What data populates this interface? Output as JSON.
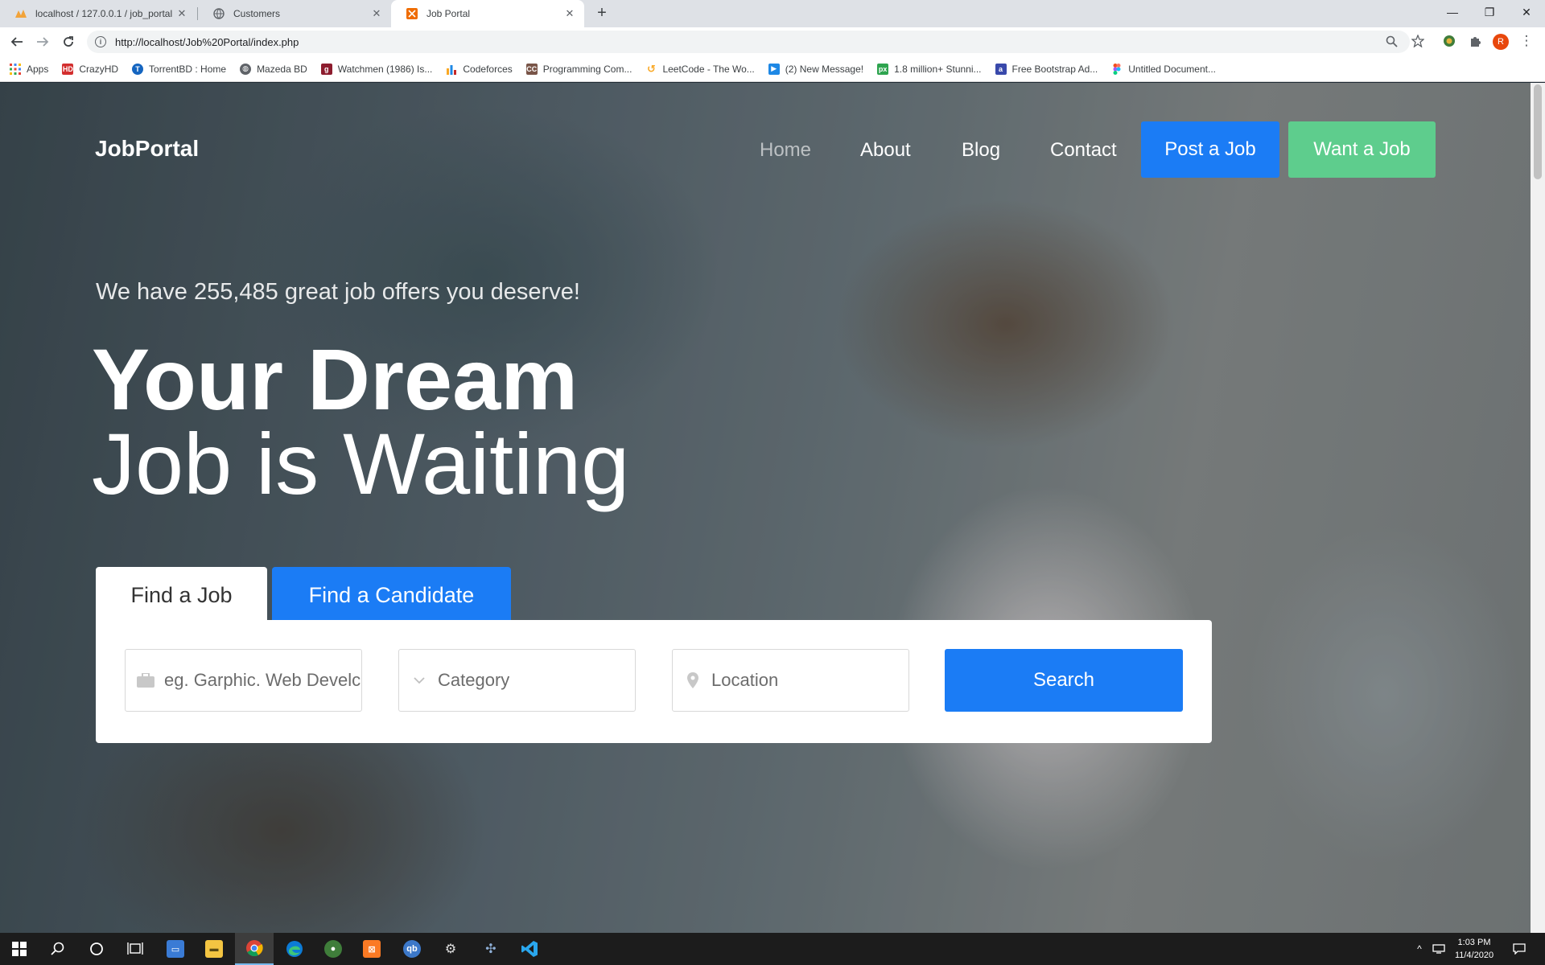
{
  "browser": {
    "tabs": [
      {
        "title": "localhost / 127.0.0.1 / job_portal",
        "icon": "phpmyadmin-icon",
        "active": false
      },
      {
        "title": "Customers",
        "icon": "globe-icon",
        "active": false
      },
      {
        "title": "Job Portal",
        "icon": "site-icon",
        "active": true
      }
    ],
    "url": "http://localhost/Job%20Portal/index.php",
    "profile_initial": "R",
    "bookmarks": [
      {
        "label": "Apps",
        "icon": "apps-grid-icon",
        "color": "#4285f4"
      },
      {
        "label": "CrazyHD",
        "icon": "crazyhd-icon",
        "color": "#d32f2f"
      },
      {
        "label": "TorrentBD : Home",
        "icon": "torrentbd-icon",
        "color": "#1565c0"
      },
      {
        "label": "Mazeda BD",
        "icon": "globe-icon",
        "color": "#5f6368"
      },
      {
        "label": "Watchmen (1986) Is...",
        "icon": "goodreads-icon",
        "color": "#8d1c2e"
      },
      {
        "label": "Codeforces",
        "icon": "codeforces-icon",
        "color": "#f9a825"
      },
      {
        "label": "Programming Com...",
        "icon": "codechef-icon",
        "color": "#795548"
      },
      {
        "label": "LeetCode - The Wo...",
        "icon": "leetcode-icon",
        "color": "#333333"
      },
      {
        "label": "(2) New Message!",
        "icon": "play-icon",
        "color": "#1e88e5"
      },
      {
        "label": "1.8 million+ Stunni...",
        "icon": "pixabay-icon",
        "color": "#2ea44f"
      },
      {
        "label": "Free Bootstrap Ad...",
        "icon": "bootstrap-icon",
        "color": "#3949ab"
      },
      {
        "label": "Untitled Document...",
        "icon": "figma-icon",
        "color": "#111111"
      }
    ]
  },
  "page": {
    "brand": "JobPortal",
    "nav": [
      "Home",
      "About",
      "Blog",
      "Contact"
    ],
    "post_job_label": "Post a Job",
    "want_job_label": "Want a Job",
    "tagline": "We have 255,485 great job offers you deserve!",
    "headline_bold": "Your Dream",
    "headline_light": "Job is Waiting",
    "tabs": [
      "Find a Job",
      "Find a Candidate"
    ],
    "search": {
      "keyword_placeholder": "eg. Garphic. Web Develc",
      "category_placeholder": "Category",
      "location_placeholder": "Location",
      "button_label": "Search"
    },
    "colors": {
      "primary": "#1b7cf5",
      "success": "#5ecd8d"
    }
  },
  "taskbar": {
    "apps": [
      "windows-start-icon",
      "search-icon",
      "cortana-icon",
      "task-view-icon",
      "file-manager-icon",
      "file-explorer-icon",
      "chrome-icon",
      "edge-icon",
      "app-icon",
      "xampp-icon",
      "qbittorrent-icon",
      "app-icon",
      "app-icon",
      "vscode-icon"
    ],
    "time": "1:03 PM",
    "date": "11/4/2020"
  }
}
